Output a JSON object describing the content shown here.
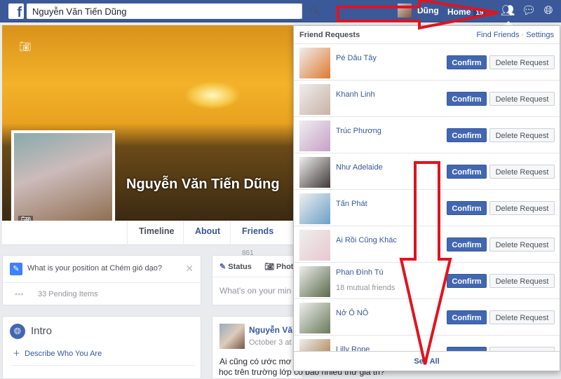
{
  "topbar": {
    "logo": "f",
    "search_value": "Nguyễn Văn Tiến Dũng",
    "user_name": "Dũng",
    "home_label": "Home",
    "home_badge": "19"
  },
  "profile": {
    "name": "Nguyễn Văn Tiến Dũng",
    "tabs": [
      {
        "label": "Timeline"
      },
      {
        "label": "About"
      },
      {
        "label": "Friends",
        "count": "861"
      }
    ]
  },
  "prompt": {
    "question": "What is your position at Chém gió dạo?",
    "pending": "33 Pending Items"
  },
  "intro": {
    "title": "Intro",
    "describe": "Describe Who You Are"
  },
  "composer": {
    "status": "Status",
    "photo": "Phot",
    "placeholder": "What's on your min"
  },
  "post": {
    "author": "Nguyễn Vă",
    "time": "October 3 at 8",
    "line1": "Ai cũng có ước mơ",
    "line2": "học trên trường lớp có bao nhiêu thứ gia tri?"
  },
  "friend_requests": {
    "title": "Friend Requests",
    "find_friends": "Find Friends",
    "separator": "·",
    "settings": "Settings",
    "confirm": "Confirm",
    "delete": "Delete Request",
    "see_all": "See All",
    "items": [
      {
        "name": "Pé Dâu Tây",
        "color": "#e07a30"
      },
      {
        "name": "Khanh Linh",
        "color": "#c9b2a6"
      },
      {
        "name": "Trúc Phương",
        "color": "#c8a0c8"
      },
      {
        "name": "Như Adelaide",
        "color": "#403838"
      },
      {
        "name": "Tấn Phát",
        "color": "#6aa0c8"
      },
      {
        "name": "Ai Rồi Cũng Khác",
        "color": "#e8c8d0"
      },
      {
        "name": "Phan Đình Tú",
        "mutual": "18 mutual friends",
        "color": "#5a6a4a"
      },
      {
        "name": "Nở Ô NÔ",
        "color": "#6a7a5a"
      },
      {
        "name": "Lilly Rope",
        "color": "#a06a30"
      }
    ]
  },
  "annotation_color": "#e0141e"
}
